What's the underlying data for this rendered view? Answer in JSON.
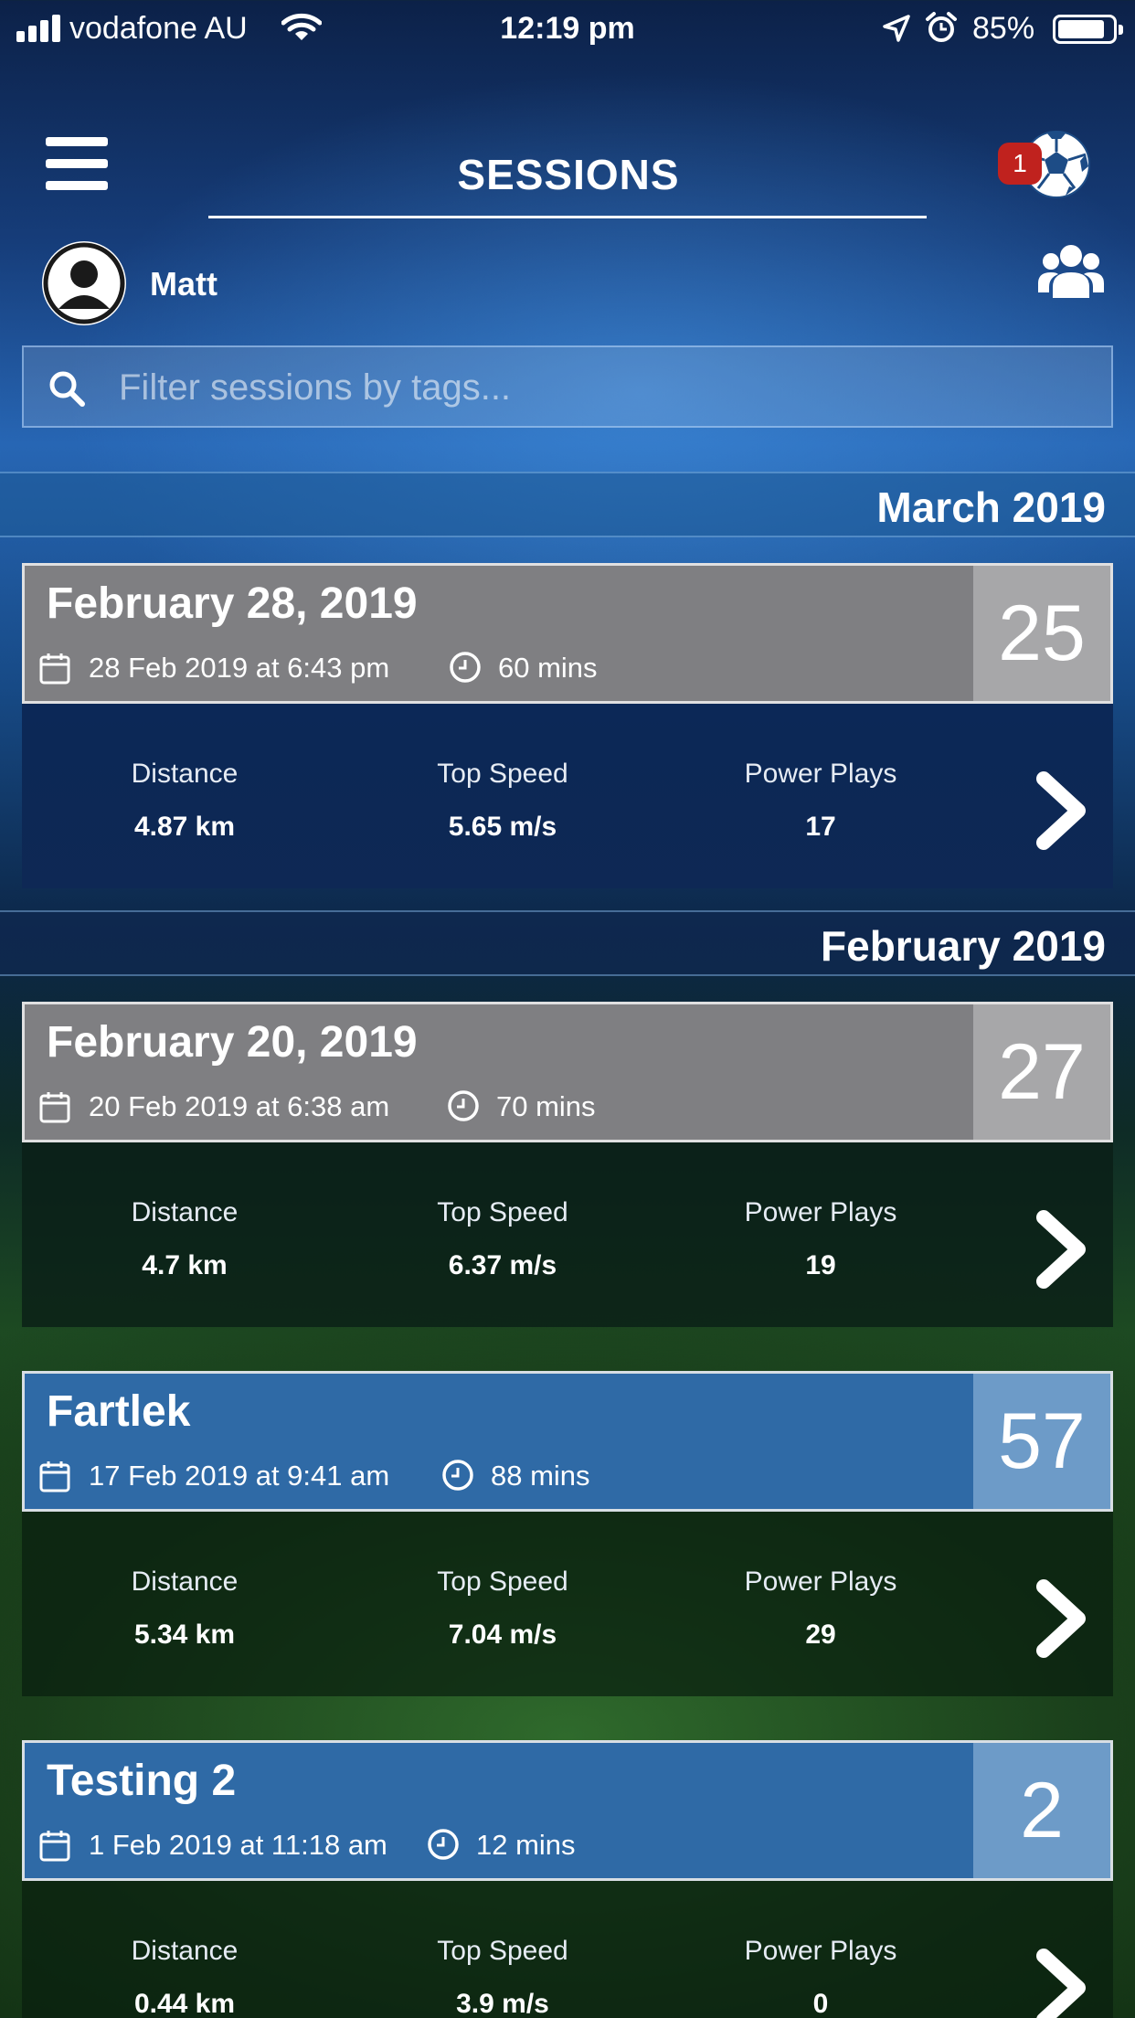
{
  "status_bar": {
    "carrier": "vodafone AU",
    "time": "12:19 pm",
    "battery": "85%"
  },
  "header": {
    "title": "SESSIONS",
    "notification_count": "1"
  },
  "user": {
    "name": "Matt"
  },
  "search": {
    "placeholder": "Filter sessions by tags..."
  },
  "stat_labels": {
    "distance": "Distance",
    "top_speed": "Top Speed",
    "power_plays": "Power Plays"
  },
  "months": [
    {
      "label": "March 2019",
      "sessions": [
        {
          "title": "February 28, 2019",
          "datetime": "28 Feb 2019 at 6:43 pm",
          "duration": "60 mins",
          "score": "25",
          "distance": "4.87 km",
          "top_speed": "5.65 m/s",
          "power_plays": "17",
          "style": "gray"
        }
      ]
    },
    {
      "label": "February 2019",
      "sessions": [
        {
          "title": "February 20, 2019",
          "datetime": "20 Feb 2019 at 6:38 am",
          "duration": "70 mins",
          "score": "27",
          "distance": "4.7 km",
          "top_speed": "6.37 m/s",
          "power_plays": "19",
          "style": "gray"
        },
        {
          "title": "Fartlek",
          "datetime": "17 Feb 2019 at 9:41 am",
          "duration": "88 mins",
          "score": "57",
          "distance": "5.34 km",
          "top_speed": "7.04 m/s",
          "power_plays": "29",
          "style": "blue"
        },
        {
          "title": "Testing 2",
          "datetime": "1 Feb 2019 at 11:18 am",
          "duration": "12 mins",
          "score": "2",
          "distance": "0.44 km",
          "top_speed": "3.9 m/s",
          "power_plays": "0",
          "style": "blue"
        }
      ]
    }
  ],
  "colors": {
    "card_gray": "#7f7f82",
    "score_gray": "#a7a7a9",
    "card_blue": "#2f6aa6",
    "score_blue": "#6d9bc8",
    "badge_red": "#c0221e"
  }
}
